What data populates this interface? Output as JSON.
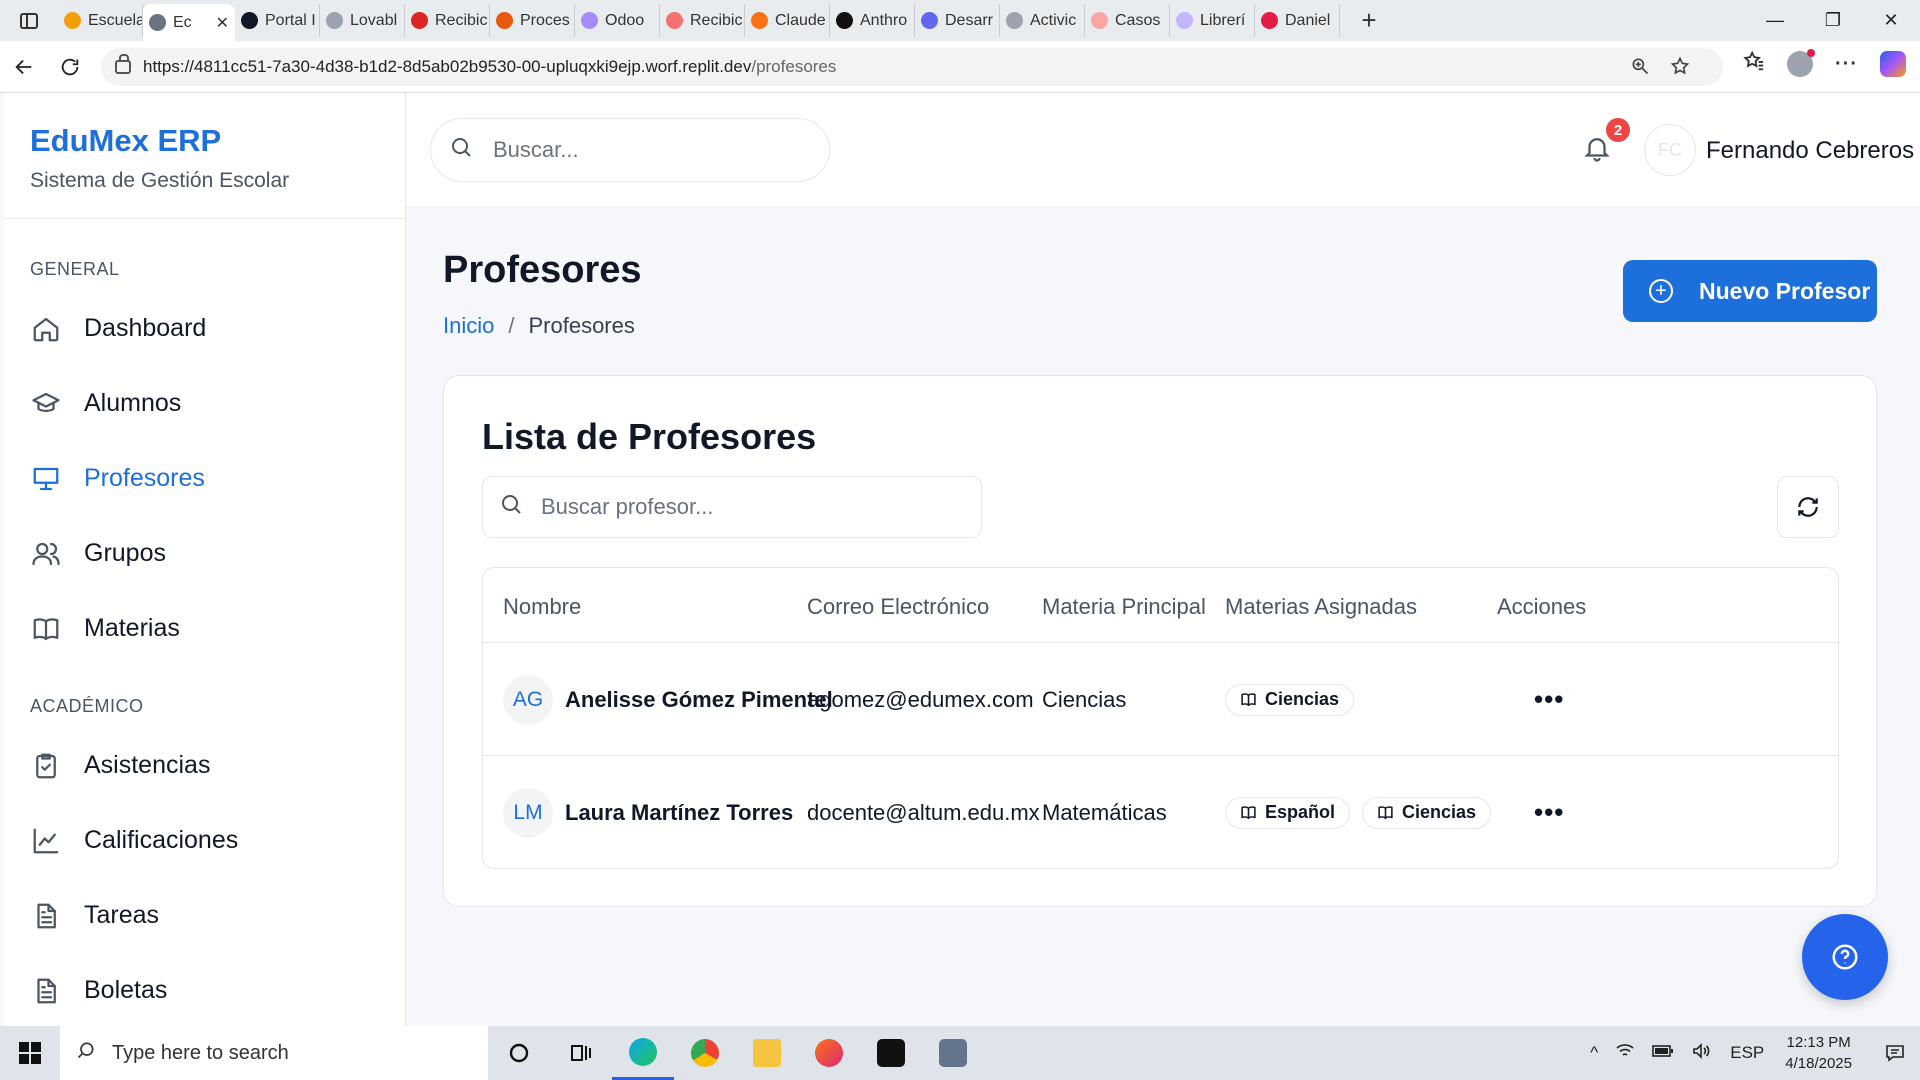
{
  "browser": {
    "tabs": [
      {
        "label": "Escuela",
        "color": "#f59e0b"
      },
      {
        "label": "Ec",
        "color": "#6b7280",
        "active": true
      },
      {
        "label": "Portal I",
        "color": "#111827"
      },
      {
        "label": "Lovabl",
        "color": "#9ca3af"
      },
      {
        "label": "Recibic",
        "color": "#dc2626"
      },
      {
        "label": "Proces",
        "color": "#ea580c"
      },
      {
        "label": "Odoo",
        "color": "#a78bfa"
      },
      {
        "label": "Recibic",
        "color": "#f87171"
      },
      {
        "label": "Claude",
        "color": "#f97316"
      },
      {
        "label": "Anthro",
        "color": "#111111"
      },
      {
        "label": "Desarr",
        "color": "#6366f1"
      },
      {
        "label": "Activic",
        "color": "#9ca3af"
      },
      {
        "label": "Casos",
        "color": "#fca5a5"
      },
      {
        "label": "Librerí",
        "color": "#c4b5fd"
      },
      {
        "label": "Daniel",
        "color": "#e11d48"
      }
    ],
    "tab_close": "✕",
    "new_tab": "+",
    "url_host": "https://4811cc51-7a30-4d38-b1d2-8d5ab02b9530-00-upluqxki9ejp.worf.replit.dev",
    "url_path": "/profesores",
    "win_minimize": "—",
    "win_maximize": "❐",
    "win_close": "✕"
  },
  "sidebar": {
    "brand_title": "EduMex ERP",
    "brand_sub": "Sistema de Gestión Escolar",
    "section_general": "GENERAL",
    "section_academico": "ACADÉMICO",
    "general_items": [
      {
        "label": "Dashboard",
        "icon": "home-icon"
      },
      {
        "label": "Alumnos",
        "icon": "graduation-cap-icon"
      },
      {
        "label": "Profesores",
        "icon": "presentation-icon",
        "active": true
      },
      {
        "label": "Grupos",
        "icon": "users-icon"
      },
      {
        "label": "Materias",
        "icon": "book-icon"
      }
    ],
    "academico_items": [
      {
        "label": "Asistencias",
        "icon": "clipboard-check-icon"
      },
      {
        "label": "Calificaciones",
        "icon": "line-chart-icon"
      },
      {
        "label": "Tareas",
        "icon": "file-text-icon"
      },
      {
        "label": "Boletas",
        "icon": "file-text-icon"
      }
    ]
  },
  "topbar": {
    "search_placeholder": "Buscar...",
    "notifications_count": "2",
    "user_initials": "FC",
    "user_name": "Fernando Cebreros"
  },
  "page": {
    "title": "Profesores",
    "breadcrumb_home": "Inicio",
    "breadcrumb_sep": "/",
    "breadcrumb_current": "Profesores",
    "new_button": "Nuevo Profesor"
  },
  "card": {
    "title": "Lista de Profesores",
    "search_placeholder": "Buscar profesor...",
    "columns": [
      "Nombre",
      "Correo Electrónico",
      "Materia Principal",
      "Materias Asignadas",
      "Acciones"
    ],
    "rows": [
      {
        "initials": "AG",
        "name": "Anelisse Gómez Pimentel",
        "email": "agomez@edumex.com",
        "main_subject": "Ciencias",
        "subjects": [
          "Ciencias"
        ],
        "actions": "•••"
      },
      {
        "initials": "LM",
        "name": "Laura Martínez Torres",
        "email": "docente@altum.edu.mx",
        "main_subject": "Matemáticas",
        "subjects": [
          "Español",
          "Ciencias"
        ],
        "actions": "•••"
      }
    ]
  },
  "taskbar": {
    "search_placeholder": "Type here to search",
    "language": "ESP",
    "time": "12:13 PM",
    "date": "4/18/2025"
  }
}
